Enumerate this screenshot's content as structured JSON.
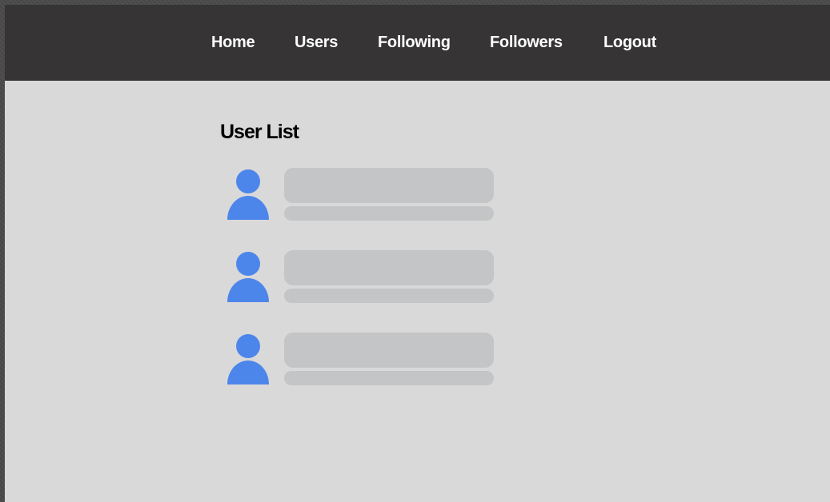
{
  "nav": {
    "items": [
      {
        "label": "Home"
      },
      {
        "label": "Users"
      },
      {
        "label": "Following"
      },
      {
        "label": "Followers"
      },
      {
        "label": "Logout"
      }
    ]
  },
  "page": {
    "title": "User List"
  },
  "users": [
    {
      "avatar_icon": "user-icon"
    },
    {
      "avatar_icon": "user-icon"
    },
    {
      "avatar_icon": "user-icon"
    }
  ],
  "colors": {
    "navbar_bg": "#363435",
    "page_bg": "#d9d9d9",
    "avatar": "#4d86ea",
    "placeholder": "#c4c5c7"
  }
}
